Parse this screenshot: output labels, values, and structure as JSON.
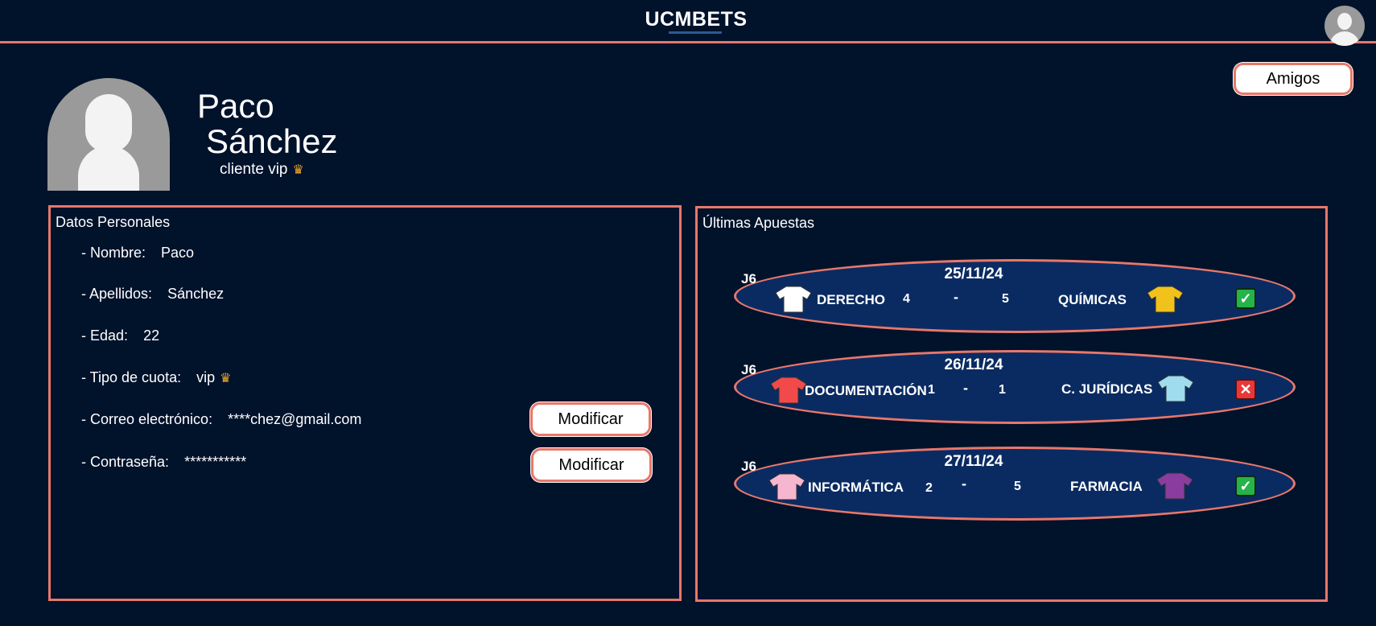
{
  "header": {
    "logo": "UCMBETS",
    "avatar": "user-avatar"
  },
  "friends_button": "Amigos",
  "profile": {
    "first_name": "Paco",
    "last_name": "Sánchez",
    "client_label": "cliente",
    "tier": "vip"
  },
  "personal": {
    "title": "Datos Personales",
    "fields": [
      {
        "label": "- Nombre:",
        "value": "Paco"
      },
      {
        "label": "- Apellidos:",
        "value": "Sánchez"
      },
      {
        "label": "- Edad:",
        "value": "22"
      },
      {
        "label": "- Tipo de cuota:",
        "value": "vip"
      },
      {
        "label": "- Correo electrónico:",
        "value": "****chez@gmail.com"
      },
      {
        "label": "- Contraseña:",
        "value": "***********"
      }
    ],
    "modify_email": "Modificar",
    "modify_password": "Modificar"
  },
  "bets": {
    "title": "Últimas Apuestas",
    "items": [
      {
        "round": "J6",
        "date": "25/11/24",
        "home": "DERECHO",
        "home_score": "4",
        "sep": "-",
        "away_score": "5",
        "away": "QUÍMICAS",
        "home_color": "#ffffff",
        "away_color": "#f2c21c",
        "result": "won"
      },
      {
        "round": "J6",
        "date": "26/11/24",
        "home": "DOCUMENTACIÓN",
        "home_score": "1",
        "sep": "-",
        "away_score": "1",
        "away": "C. JURÍDICAS",
        "home_color": "#f24a4a",
        "away_color": "#9fdcee",
        "result": "lost"
      },
      {
        "round": "J6",
        "date": "27/11/24",
        "home": "INFORMÁTICA",
        "home_score": "2",
        "sep": "-",
        "away_score": "5",
        "away": "FARMACIA",
        "home_color": "#f7b6cf",
        "away_color": "#8a3d9e",
        "result": "won"
      }
    ]
  },
  "colors": {
    "background": "#01122b",
    "accent": "#e8776a",
    "card": "#0a2b62"
  }
}
